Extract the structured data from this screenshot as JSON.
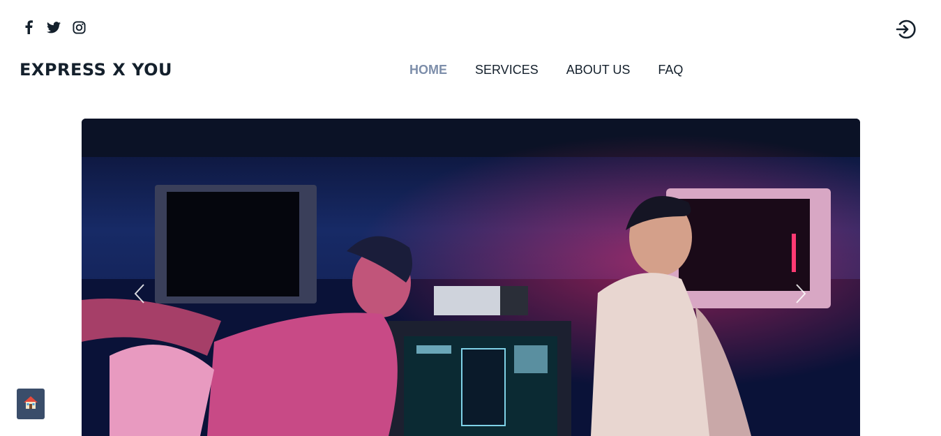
{
  "header": {
    "social": [
      {
        "name": "facebook-icon"
      },
      {
        "name": "twitter-icon"
      },
      {
        "name": "instagram-icon"
      }
    ],
    "login_icon": "login-icon"
  },
  "brand": {
    "name": "EXPRESS X YOU"
  },
  "nav": {
    "items": [
      {
        "label": "HOME",
        "active": true
      },
      {
        "label": "SERVICES",
        "active": false
      },
      {
        "label": "ABOUT US",
        "active": false
      },
      {
        "label": "FAQ",
        "active": false
      }
    ]
  },
  "hero": {
    "image": "two people sitting by retro televisions in neon light",
    "prev_icon": "chevron-left-icon",
    "next_icon": "chevron-right-icon"
  },
  "floating": {
    "home_icon": "house-icon"
  },
  "colors": {
    "text": "#14202c",
    "nav_active": "#7d8eaa",
    "home_button": "#3a4d6a"
  }
}
